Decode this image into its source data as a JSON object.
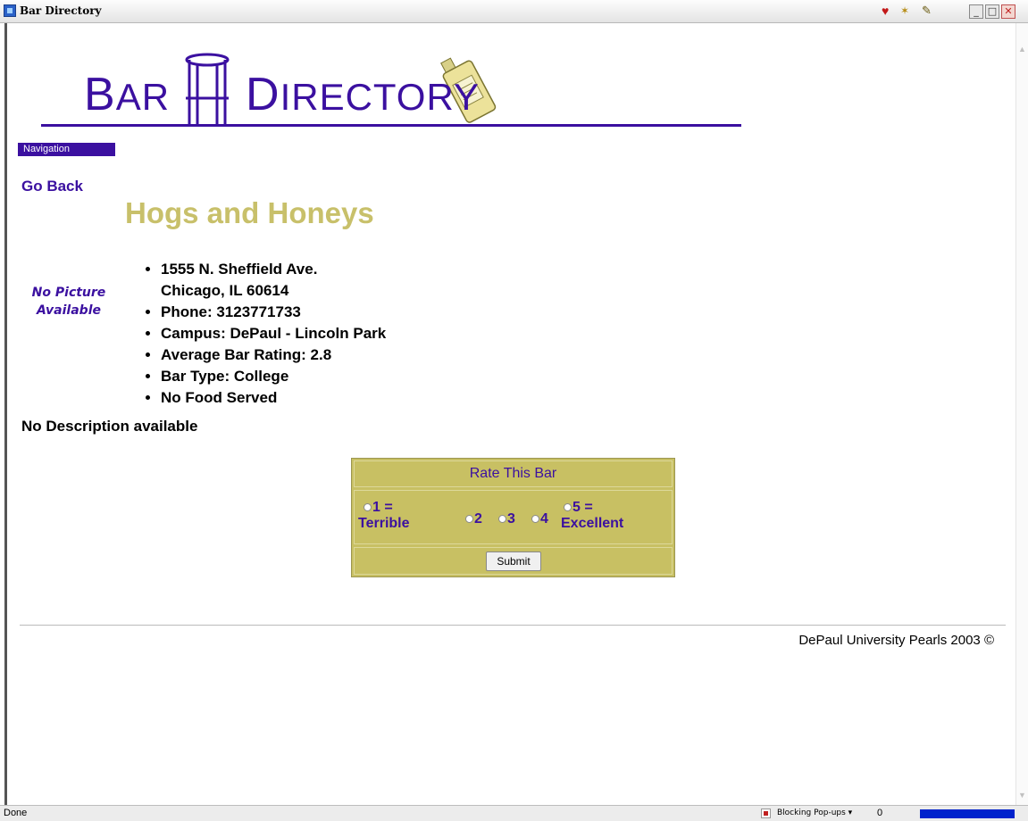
{
  "window": {
    "title": "Bar Directory",
    "icons": [
      "heart-icon",
      "star-add-icon",
      "edit-note-icon"
    ]
  },
  "banner": {
    "word1_initial": "B",
    "word1_rest": "AR",
    "word2_initial": "D",
    "word2_rest": "IRECTORY"
  },
  "nav": {
    "label": "Navigation",
    "go_back": "Go Back"
  },
  "bar": {
    "name": "Hogs and Honeys",
    "no_picture_line1": "No Picture",
    "no_picture_line2": "Available",
    "address_line1": "1555 N. Sheffield Ave.",
    "address_line2": "Chicago, IL 60614",
    "phone": "Phone: 3123771733",
    "campus": "Campus: DePaul - Lincoln Park",
    "rating": "Average Bar Rating: 2.8",
    "type": "Bar Type: College",
    "food": "No Food Served",
    "description": "No Description available"
  },
  "rating_form": {
    "header": "Rate This Bar",
    "opt1_line1": "1 =",
    "opt1_line2": "Terrible",
    "opt2": "2",
    "opt3": "3",
    "opt4": "4",
    "opt5_line1": "5 =",
    "opt5_line2": "Excellent",
    "submit": "Submit"
  },
  "footer": {
    "copyright": "DePaul University Pearls 2003 ©"
  },
  "status": {
    "text": "Done",
    "popups": "Blocking Pop-ups",
    "count": "0"
  },
  "colors": {
    "brand_purple": "#3b10a0",
    "olive": "#c8c063"
  }
}
